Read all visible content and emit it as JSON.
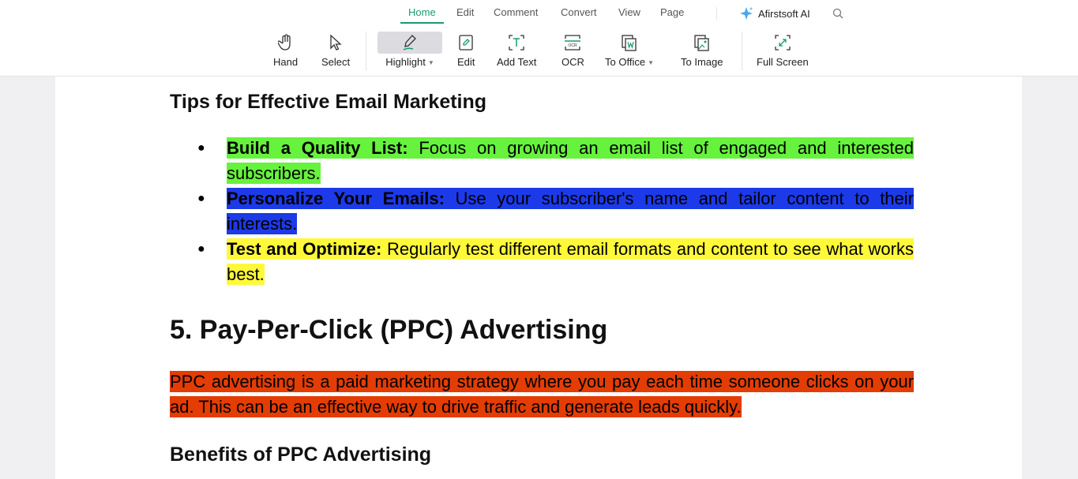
{
  "menu": {
    "tabs": [
      "Home",
      "Edit",
      "Comment",
      "Convert",
      "View",
      "Page"
    ],
    "active": "Home",
    "ai_label": "Afirstsoft AI"
  },
  "toolbar": [
    {
      "label": "Hand",
      "icon": "hand-icon"
    },
    {
      "label": "Select",
      "icon": "cursor-icon"
    },
    {
      "label": "Highlight",
      "icon": "highlighter-icon",
      "dropdown": true,
      "selected": true
    },
    {
      "label": "Edit",
      "icon": "edit-document-icon"
    },
    {
      "label": "Add Text",
      "icon": "add-text-icon"
    },
    {
      "label": "OCR",
      "icon": "ocr-icon"
    },
    {
      "label": "To Office",
      "icon": "to-office-icon",
      "dropdown": true
    },
    {
      "label": "To Image",
      "icon": "to-image-icon"
    },
    {
      "label": "Full Screen",
      "icon": "full-screen-icon"
    }
  ],
  "colors": {
    "accent": "#1a9b6c",
    "green": "#66f23d",
    "blue": "#1c3ae8",
    "yellow": "#fff93a",
    "orange": "#e33d04"
  },
  "doc": {
    "heading1": "Tips for Effective Email Marketing",
    "tips": [
      {
        "bold": "Build a Quality List:",
        "text": " Focus on growing an email list of engaged and interested subscribers.",
        "color": "#66f23d"
      },
      {
        "bold": "Personalize Your Emails:",
        "text": " Use your subscriber's name and tailor content to their interests.",
        "color": "#1c3ae8"
      },
      {
        "bold": "Test and Optimize:",
        "text": " Regularly test different email formats and content to see what works best.",
        "color": "#fff93a"
      }
    ],
    "heading2": "5. Pay-Per-Click (PPC) Advertising",
    "paragraph": "PPC advertising is a paid marketing strategy where you pay each time someone clicks on your ad. This can be an effective way to drive traffic and generate leads quickly.",
    "paragraph_color": "#e33d04",
    "heading3": "Benefits of PPC Advertising"
  }
}
